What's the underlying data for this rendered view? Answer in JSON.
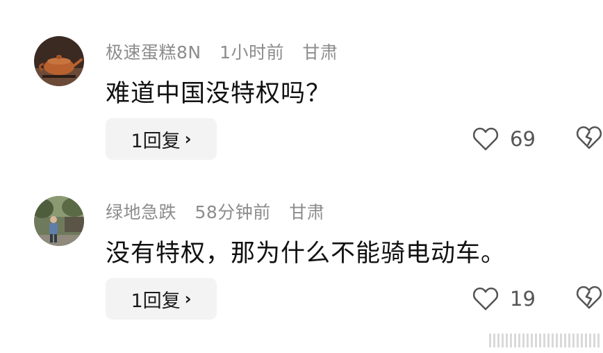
{
  "comments": [
    {
      "username": "极速蛋糕8N",
      "time": "1小时前",
      "location": "甘肃",
      "text": "难道中国没特权吗？",
      "reply_label": "1回复",
      "likes": "69",
      "avatar_icon": "teapot-avatar"
    },
    {
      "username": "绿地急跌",
      "time": "58分钟前",
      "location": "甘肃",
      "text": "没有特权，那为什么不能骑电动车。",
      "reply_label": "1回复",
      "likes": "19",
      "avatar_icon": "person-outdoor-avatar"
    }
  ],
  "icons": {
    "like": "heart-outline-icon",
    "dislike": "broken-heart-icon",
    "reply_chevron": "chevron-right-icon"
  },
  "colors": {
    "meta_text": "#8c8c8c",
    "reply_bg": "#f3f3f3",
    "icon_stroke": "#555555"
  }
}
